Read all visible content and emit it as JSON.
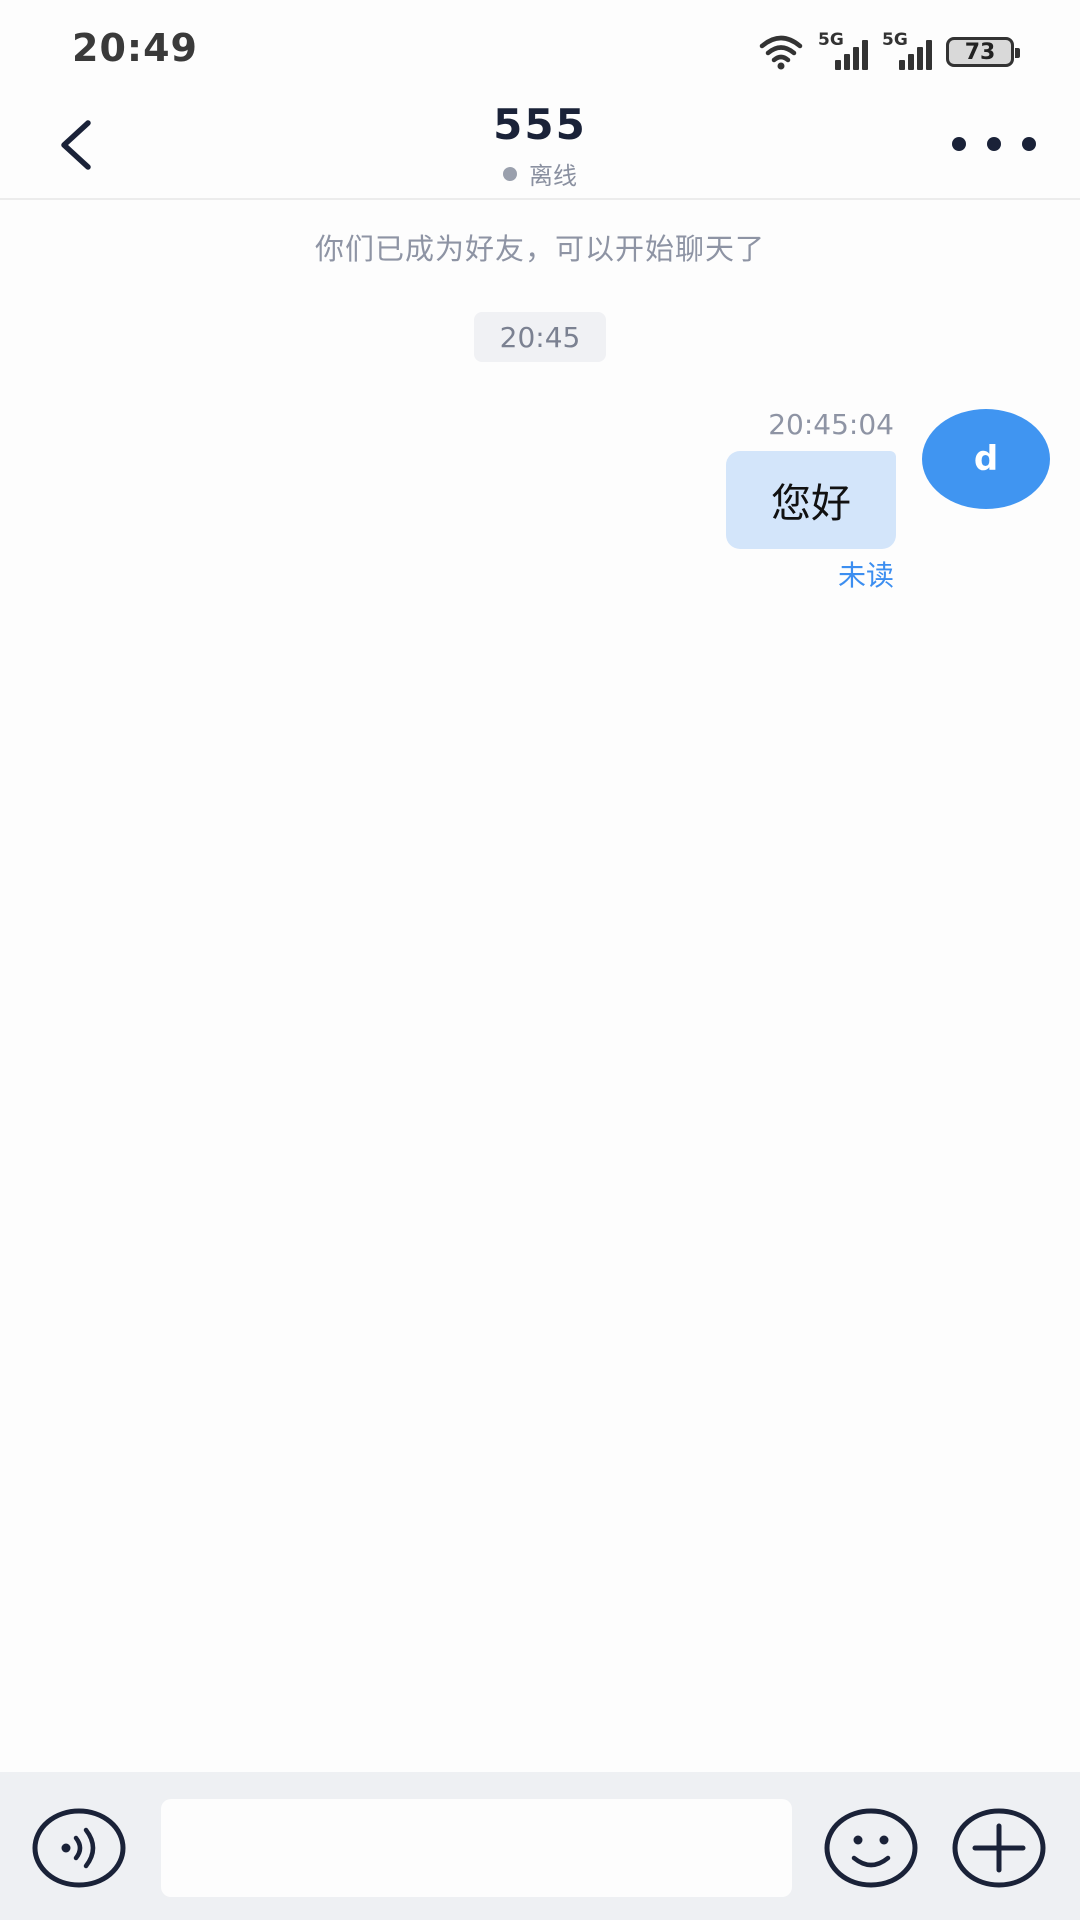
{
  "status_bar": {
    "time": "20:49",
    "network_1": "5G",
    "network_2": "5G",
    "battery": "73",
    "icons": [
      "wifi-icon",
      "signal-icon",
      "signal-icon",
      "battery-icon"
    ]
  },
  "header": {
    "title": "555",
    "presence": "离线",
    "back_icon": "chevron-left-icon",
    "more_icon": "more-horizontal-icon"
  },
  "chat": {
    "system_notice": "你们已成为好友，可以开始聊天了",
    "time_divider": "20:45",
    "messages": [
      {
        "sender_avatar": "d",
        "time": "20:45:04",
        "text": "您好",
        "read_state": "未读"
      }
    ]
  },
  "input_bar": {
    "placeholder": "",
    "icons": [
      "voice-icon",
      "emoji-icon",
      "plus-icon"
    ]
  },
  "colors": {
    "accent": "#4095f1",
    "bubble_outgoing": "#d3e5fa",
    "unread_text": "#3c8ef0",
    "muted_text": "#8e94a4",
    "title_text": "#1a2238"
  }
}
